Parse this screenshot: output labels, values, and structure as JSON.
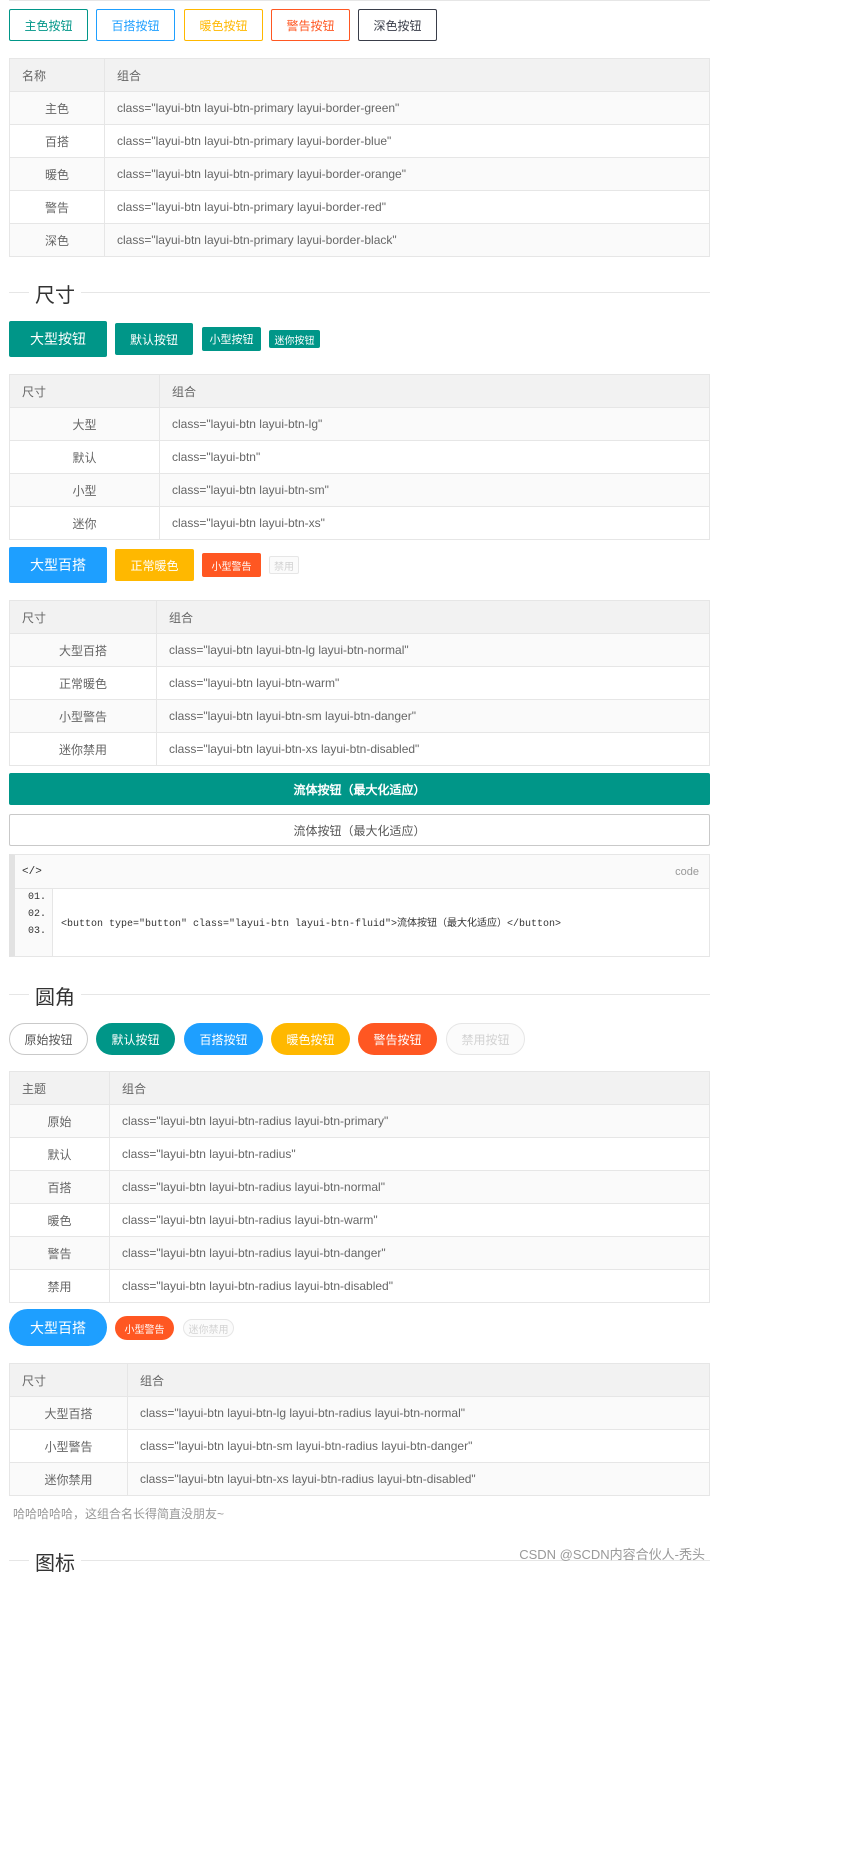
{
  "border_buttons": [
    {
      "label": "主色按钮",
      "color": "#009688"
    },
    {
      "label": "百搭按钮",
      "color": "#1e9fff"
    },
    {
      "label": "暖色按钮",
      "color": "#ffb800"
    },
    {
      "label": "警告按钮",
      "color": "#ff5722"
    },
    {
      "label": "深色按钮",
      "color": "#393d49"
    }
  ],
  "table_border": {
    "headers": [
      "名称",
      "组合"
    ],
    "rows": [
      [
        "主色",
        "class=\"layui-btn layui-btn-primary layui-border-green\""
      ],
      [
        "百搭",
        "class=\"layui-btn layui-btn-primary layui-border-blue\""
      ],
      [
        "暖色",
        "class=\"layui-btn layui-btn-primary layui-border-orange\""
      ],
      [
        "警告",
        "class=\"layui-btn layui-btn-primary layui-border-red\""
      ],
      [
        "深色",
        "class=\"layui-btn layui-btn-primary layui-border-black\""
      ]
    ]
  },
  "section_size": "尺寸",
  "size_buttons": [
    "大型按钮",
    "默认按钮",
    "小型按钮",
    "迷你按钮"
  ],
  "table_size": {
    "headers": [
      "尺寸",
      "组合"
    ],
    "rows": [
      [
        "大型",
        "class=\"layui-btn layui-btn-lg\""
      ],
      [
        "默认",
        "class=\"layui-btn\""
      ],
      [
        "小型",
        "class=\"layui-btn layui-btn-sm\""
      ],
      [
        "迷你",
        "class=\"layui-btn layui-btn-xs\""
      ]
    ]
  },
  "mix_buttons": [
    "大型百搭",
    "正常暖色",
    "小型警告",
    "禁用"
  ],
  "table_mix": {
    "headers": [
      "尺寸",
      "组合"
    ],
    "rows": [
      [
        "大型百搭",
        "class=\"layui-btn layui-btn-lg layui-btn-normal\""
      ],
      [
        "正常暖色",
        "class=\"layui-btn layui-btn-warm\""
      ],
      [
        "小型警告",
        "class=\"layui-btn layui-btn-sm layui-btn-danger\""
      ],
      [
        "迷你禁用",
        "class=\"layui-btn layui-btn-xs layui-btn-disabled\""
      ]
    ]
  },
  "fluid_button_1": "流体按钮（最大化适应）",
  "fluid_button_2": "流体按钮（最大化适应）",
  "code_block": {
    "tag": "</>",
    "label": "code",
    "line_numbers": [
      "01.",
      "02.",
      "03."
    ],
    "source": "<button type=\"button\" class=\"layui-btn layui-btn-fluid\">流体按钮（最大化适应）</button>"
  },
  "section_radius": "圆角",
  "radius_buttons": [
    "原始按钮",
    "默认按钮",
    "百搭按钮",
    "暖色按钮",
    "警告按钮",
    "禁用按钮"
  ],
  "table_radius": {
    "headers": [
      "主题",
      "组合"
    ],
    "rows": [
      [
        "原始",
        "class=\"layui-btn layui-btn-radius layui-btn-primary\""
      ],
      [
        "默认",
        "class=\"layui-btn layui-btn-radius\""
      ],
      [
        "百搭",
        "class=\"layui-btn layui-btn-radius layui-btn-normal\""
      ],
      [
        "暖色",
        "class=\"layui-btn layui-btn-radius layui-btn-warm\""
      ],
      [
        "警告",
        "class=\"layui-btn layui-btn-radius layui-btn-danger\""
      ],
      [
        "禁用",
        "class=\"layui-btn layui-btn-radius layui-btn-disabled\""
      ]
    ]
  },
  "radius_mix_buttons": [
    "大型百搭",
    "小型警告",
    "迷你禁用"
  ],
  "table_radius_mix": {
    "headers": [
      "尺寸",
      "组合"
    ],
    "rows": [
      [
        "大型百搭",
        "class=\"layui-btn layui-btn-lg layui-btn-radius layui-btn-normal\""
      ],
      [
        "小型警告",
        "class=\"layui-btn layui-btn-sm layui-btn-radius layui-btn-danger\""
      ],
      [
        "迷你禁用",
        "class=\"layui-btn layui-btn-xs layui-btn-radius layui-btn-disabled\""
      ]
    ]
  },
  "footnote": "哈哈哈哈哈，这组合名长得简直没朋友~",
  "section_icon": "图标",
  "watermark": "CSDN @SCDN内容合伙人-秃头"
}
